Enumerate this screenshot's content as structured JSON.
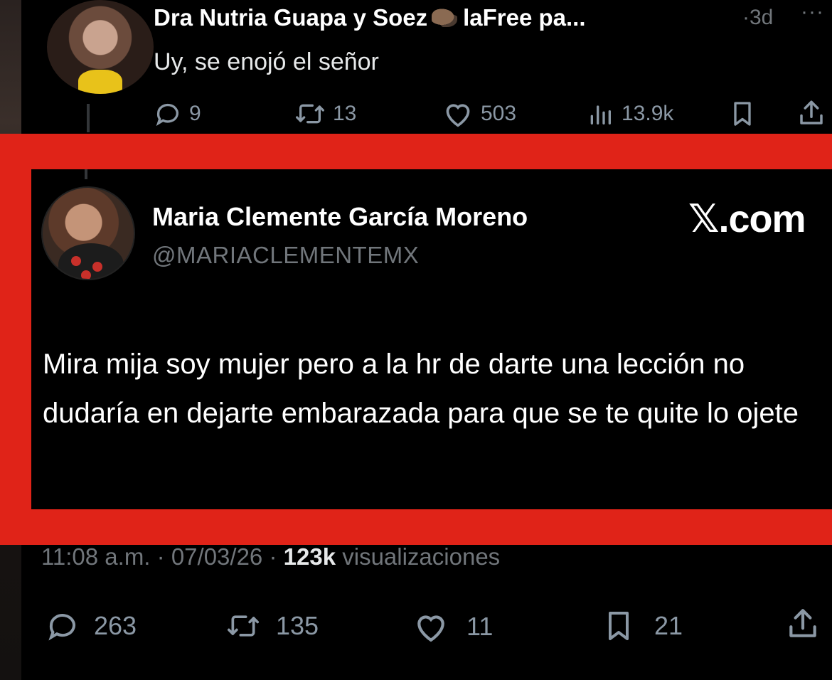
{
  "reply": {
    "author": "Dra Nutria Guapa y Soez",
    "author_suffix": "laFree pa...",
    "time": "·3d",
    "more": "···",
    "text": "Uy, se enojó el señor",
    "actions": {
      "replies": "9",
      "reposts": "13",
      "likes": "503",
      "views": "13.9k"
    }
  },
  "quoted_card": {
    "name": "Maria Clemente García Moreno",
    "handle": "@MARIACLEMENTEMX",
    "brand": "𝕏.com",
    "text": "Mira mija soy mujer pero a la hr de darte una lección no dudaría en dejarte embarazada para que se te quite lo ojete"
  },
  "main_tweet": {
    "time": "11:08 a.m.",
    "date": "07/03/26",
    "views_count": "123k",
    "views_label": "visualizaciones",
    "actions": {
      "replies": "263",
      "reposts": "135",
      "likes": "11",
      "bookmarks": "21"
    }
  },
  "colors": {
    "background": "#000000",
    "highlight_frame": "#e02318",
    "muted_text": "#71767b",
    "primary_text": "#e7e9ea"
  }
}
